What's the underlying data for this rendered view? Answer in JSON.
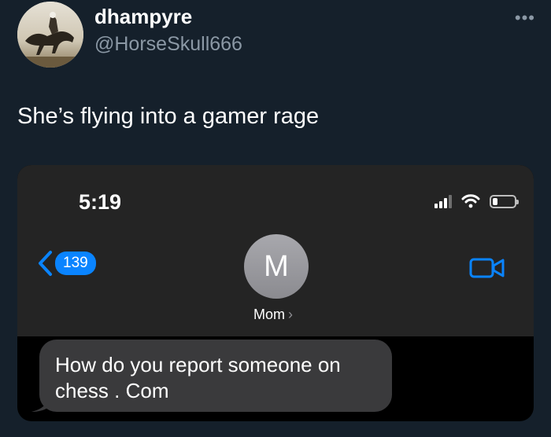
{
  "user": {
    "display_name": "dhampyre",
    "handle": "@HorseSkull666"
  },
  "more_label": "•••",
  "tweet_text": "She’s flying into a gamer rage",
  "phone": {
    "time": "5:19",
    "back_count": "139",
    "contact_initial": "M",
    "contact_name": "Mom",
    "message": "How do you report someone on chess . Com"
  },
  "colors": {
    "background": "#15202b",
    "secondary_text": "#8b98a5",
    "ios_blue": "#0a84ff",
    "bubble": "#3a3a3c"
  },
  "icons": [
    "more-icon",
    "back-chevron-icon",
    "signal-icon",
    "wifi-icon",
    "battery-icon",
    "video-call-icon",
    "chevron-right-icon"
  ]
}
